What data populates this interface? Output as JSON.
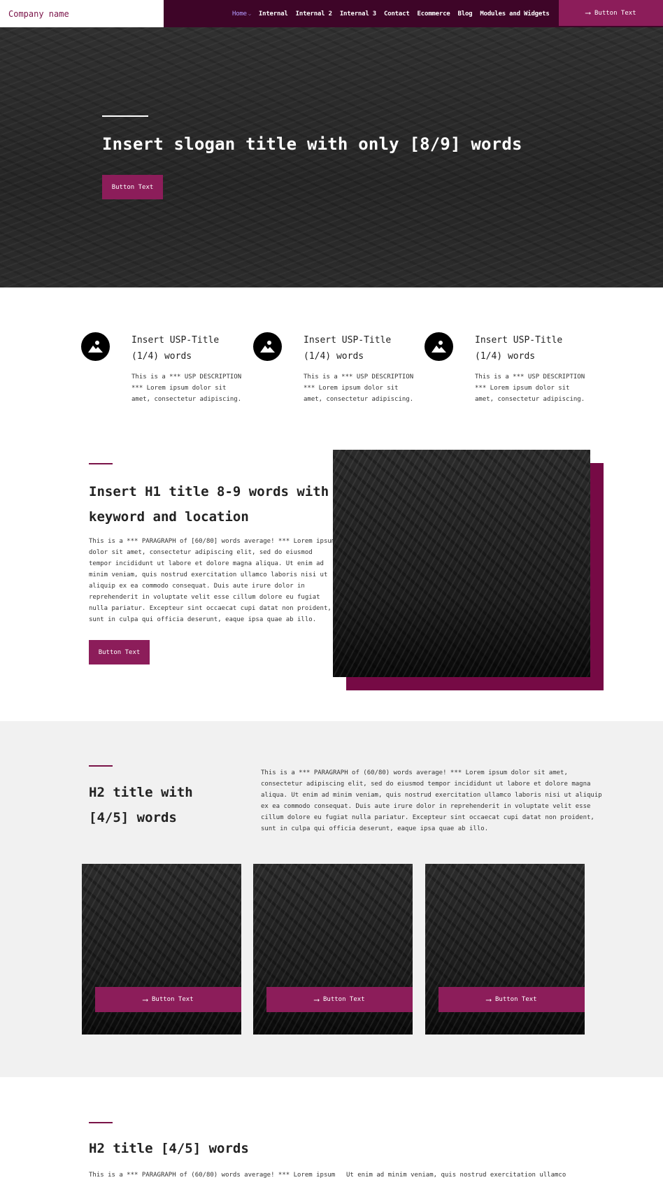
{
  "header": {
    "brand": "Company name",
    "nav": [
      {
        "label": "Home",
        "active": true
      },
      {
        "label": "Internal"
      },
      {
        "label": "Internal 2"
      },
      {
        "label": "Internal 3"
      },
      {
        "label": "Contact"
      },
      {
        "label": "Ecommerce"
      },
      {
        "label": "Blog"
      },
      {
        "label": "Modules and Widgets"
      }
    ],
    "cta_label": "Button Text"
  },
  "hero": {
    "title": "Insert slogan title with only [8/9] words",
    "button_label": "Button Text"
  },
  "usp": [
    {
      "title_line1": "Insert USP-Title",
      "title_line2": "(1/4) words",
      "desc": [
        "This is a *** USP DESCRIPTION",
        "*** Lorem ipsum dolor sit",
        "amet, consectetur adipiscing."
      ]
    },
    {
      "title_line1": "Insert USP-Title",
      "title_line2": "(1/4) words",
      "desc": [
        "This is a *** USP DESCRIPTION",
        "*** Lorem ipsum dolor sit",
        "amet, consectetur adipiscing."
      ]
    },
    {
      "title_line1": "Insert USP-Title",
      "title_line2": "(1/4) words",
      "desc": [
        "This is a *** USP DESCRIPTION",
        "*** Lorem ipsum dolor sit",
        "amet, consectetur adipiscing."
      ]
    }
  ],
  "intro": {
    "title_line1": "Insert H1 title 8-9 words with",
    "title_line2": "keyword and location",
    "paragraph": [
      "This is a *** PARAGRAPH of [60/80] words average! *** Lorem ipsum",
      "dolor sit amet, consectetur adipiscing elit, sed do eiusmod",
      "tempor incididunt ut labore et dolore magna aliqua. Ut enim ad",
      "minim veniam, quis nostrud exercitation ullamco laboris nisi ut",
      "aliquip ex ea commodo consequat. Duis aute irure dolor in",
      "reprehenderit in voluptate velit esse cillum dolore eu fugiat",
      "nulla pariatur. Excepteur sint occaecat cupi datat non proident,",
      "sunt in culpa qui officia deserunt, eaque ipsa quae ab illo."
    ],
    "button_label": "Button Text"
  },
  "section2": {
    "title_line1": "H2 title with",
    "title_line2": "[4/5] words",
    "paragraph": [
      "This is a *** PARAGRAPH of (60/80) words average! *** Lorem ipsum dolor sit amet,",
      "consectetur adipiscing elit, sed do eiusmod tempor incididunt ut labore et dolore magna",
      "aliqua. Ut enim ad minim veniam, quis nostrud exercitation ullamco laboris nisi ut aliquip",
      "ex ea commodo consequat. Duis aute irure dolor in reprehenderit in voluptate velit esse",
      "cillum dolore eu fugiat nulla pariatur. Excepteur sint occaecat cupi datat non proident,",
      "sunt in culpa qui officia deserunt, eaque ipsa quae ab illo."
    ],
    "cards": [
      {
        "button_label": "Button Text"
      },
      {
        "button_label": "Button Text"
      },
      {
        "button_label": "Button Text"
      }
    ]
  },
  "section3": {
    "title": "H2 title [4/5] words",
    "col1_line": "This is a *** PARAGRAPH of (60/80) words average! *** Lorem ipsum",
    "col2_line": "Ut enim ad minim veniam, quis nostrud exercitation ullamco"
  },
  "colors": {
    "accent": "#8c1d5a",
    "nav_bg": "#3e0528",
    "shadow_block": "#760a45",
    "grey_bg": "#f1f1f1"
  }
}
